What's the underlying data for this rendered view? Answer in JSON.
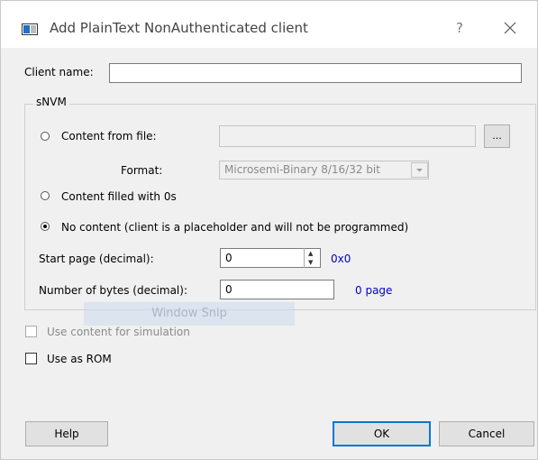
{
  "window": {
    "title": "Add PlainText NonAuthenticated client",
    "help_glyph": "?"
  },
  "client_name": {
    "label": "Client name:",
    "value": ""
  },
  "snvm": {
    "group_title": "sNVM",
    "content_from_file": {
      "label": "Content from file:",
      "value": "",
      "browse_label": "...",
      "selected": false
    },
    "format": {
      "label": "Format:",
      "selected": "Microsemi-Binary 8/16/32 bit"
    },
    "content_filled_zeros": {
      "label": "Content filled with 0s",
      "selected": false
    },
    "no_content": {
      "label": "No content (client is a placeholder and will not be programmed)",
      "selected": true
    },
    "start_page": {
      "label": "Start page (decimal):",
      "value": "0",
      "hex": "0x0"
    },
    "num_bytes": {
      "label": "Number of bytes (decimal):",
      "value": "0",
      "pages": "0 page"
    }
  },
  "snip_overlay": "Window Snip",
  "use_content_sim": {
    "label": "Use content for simulation",
    "checked": false,
    "disabled": true
  },
  "use_as_rom": {
    "label": "Use as ROM",
    "checked": false
  },
  "buttons": {
    "help": "Help",
    "ok": "OK",
    "cancel": "Cancel"
  },
  "colors": {
    "link_blue": "#0000cc",
    "default_button_border": "#0078d7"
  }
}
